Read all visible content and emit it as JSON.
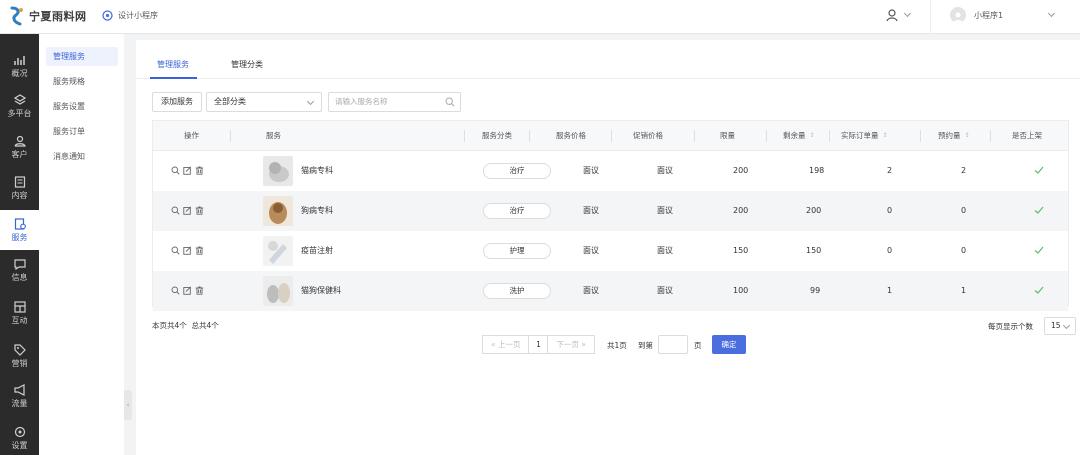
{
  "header": {
    "logo_text": "宁夏雨料网",
    "mini_program_link": "设计小程序",
    "account_name": "小程序1"
  },
  "sidebar": {
    "items": [
      {
        "label": "概况",
        "icon": "chart-icon"
      },
      {
        "label": "多平台",
        "icon": "layers-icon"
      },
      {
        "label": "客户",
        "icon": "user-icon"
      },
      {
        "label": "内容",
        "icon": "document-icon"
      },
      {
        "label": "服务",
        "icon": "service-icon",
        "active": true
      },
      {
        "label": "信息",
        "icon": "message-icon"
      },
      {
        "label": "互动",
        "icon": "interaction-icon"
      },
      {
        "label": "营销",
        "icon": "tag-icon"
      },
      {
        "label": "流量",
        "icon": "megaphone-icon"
      },
      {
        "label": "设置",
        "icon": "settings-icon"
      }
    ]
  },
  "submenu": {
    "items": [
      {
        "label": "管理服务",
        "active": true
      },
      {
        "label": "服务规格"
      },
      {
        "label": "服务设置"
      },
      {
        "label": "服务订单"
      },
      {
        "label": "消息通知"
      }
    ]
  },
  "tabs": [
    {
      "label": "管理服务",
      "active": true
    },
    {
      "label": "管理分类"
    }
  ],
  "toolbar": {
    "add_label": "添加服务",
    "category_value": "全部分类",
    "search_placeholder": "请输入服务名称"
  },
  "table": {
    "headers": {
      "ops": "操作",
      "service": "服务",
      "category": "服务分类",
      "price": "服务价格",
      "promo": "促销价格",
      "limit": "限量",
      "remaining": "剩余量",
      "orders": "实际订单量",
      "booked": "预约量",
      "listed": "是否上架"
    },
    "rows": [
      {
        "name": "猫病专科",
        "category": "治疗",
        "price": "面议",
        "promo": "面议",
        "limit": "200",
        "remaining": "198",
        "orders": "2",
        "booked": "2"
      },
      {
        "name": "狗病专科",
        "category": "治疗",
        "price": "面议",
        "promo": "面议",
        "limit": "200",
        "remaining": "200",
        "orders": "0",
        "booked": "0"
      },
      {
        "name": "疫苗注射",
        "category": "护理",
        "price": "面议",
        "promo": "面议",
        "limit": "150",
        "remaining": "150",
        "orders": "0",
        "booked": "0"
      },
      {
        "name": "猫狗保健科",
        "category": "洗护",
        "price": "面议",
        "promo": "面议",
        "limit": "100",
        "remaining": "99",
        "orders": "1",
        "booked": "1"
      }
    ]
  },
  "footer": {
    "count_text": "本页共4个  总共4个",
    "prev_label": "上一页",
    "current_page": "1",
    "next_label": "下一页",
    "total_pages": "共1页",
    "goto_label": "到第",
    "page_unit": "页",
    "confirm_label": "确定",
    "page_size_label": "每页显示个数",
    "page_size_value": "15"
  },
  "colors": {
    "accent": "#3a62d7",
    "sidebar_bg": "#2b2b2b",
    "check_green": "#5bbf6a"
  }
}
